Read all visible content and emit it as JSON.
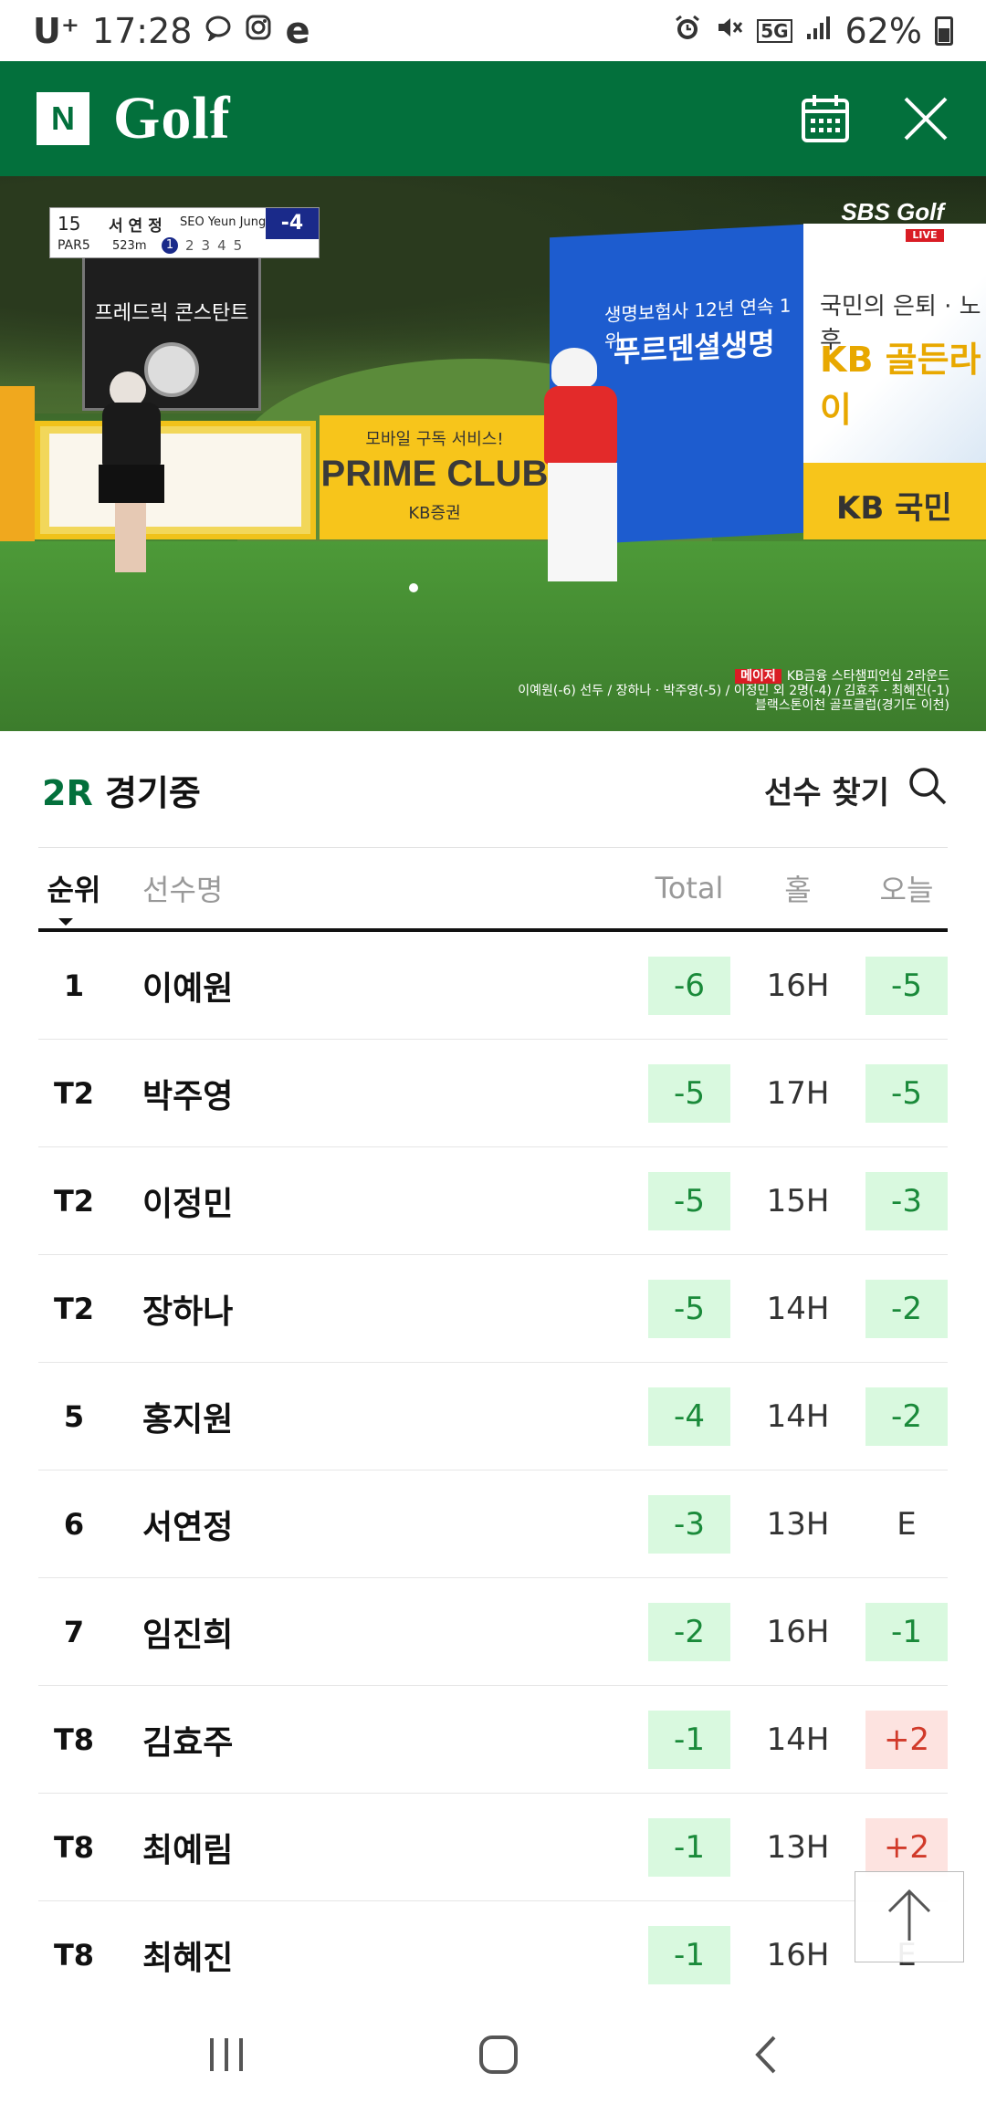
{
  "status_bar": {
    "carrier": "U⁺",
    "time": "17:28",
    "network": "5G",
    "battery": "62%"
  },
  "app": {
    "logo_letter": "N",
    "title": "Golf"
  },
  "video": {
    "score_overlay": {
      "hole": "15",
      "par": "PAR5",
      "player_kr": "서 연 정",
      "player_en": "SEO Yeun Jung",
      "distance": "523m",
      "shots": [
        "1",
        "2",
        "3",
        "4",
        "5"
      ],
      "relative": "-4"
    },
    "broadcaster": "SBS Golf",
    "live": "LIVE",
    "ticker_tag": "메이저",
    "ticker_line1": "KB금융 스타챔피언십 2라운드",
    "ticker_line2": "이예원(-6) 선두 / 장하나 · 박주영(-5) / 이정민 외 2명(-4) / 김효주 · 최혜진(-1)",
    "ticker_line3": "블랙스톤이천 골프클럽(경기도 이천)",
    "signs": {
      "dark_sign": "프레드릭 콘스탄트",
      "prime_small": "모바일 구독 서비스!",
      "prime_big": "PRIME CLUB",
      "prime_kb": "KB증권",
      "blue_line1": "생명보험사 12년 연속 1위",
      "blue_line2": "푸르덴셜생명",
      "kb_line1": "국민의 은퇴 · 노후",
      "kb_line2": "KB 골든라이",
      "kb_bottom": "KB 국민"
    }
  },
  "leaderboard": {
    "round_highlight": "2R",
    "round_status": "경기중",
    "search_label": "선수 찾기",
    "columns": {
      "rank": "순위",
      "name": "선수명",
      "total": "Total",
      "hole": "홀",
      "today": "오늘"
    },
    "rows": [
      {
        "rank": "1",
        "name": "이예원",
        "total": "-6",
        "hole": "16H",
        "today": "-5",
        "today_kind": "neg"
      },
      {
        "rank": "T2",
        "name": "박주영",
        "total": "-5",
        "hole": "17H",
        "today": "-5",
        "today_kind": "neg"
      },
      {
        "rank": "T2",
        "name": "이정민",
        "total": "-5",
        "hole": "15H",
        "today": "-3",
        "today_kind": "neg"
      },
      {
        "rank": "T2",
        "name": "장하나",
        "total": "-5",
        "hole": "14H",
        "today": "-2",
        "today_kind": "neg"
      },
      {
        "rank": "5",
        "name": "홍지원",
        "total": "-4",
        "hole": "14H",
        "today": "-2",
        "today_kind": "neg"
      },
      {
        "rank": "6",
        "name": "서연정",
        "total": "-3",
        "hole": "13H",
        "today": "E",
        "today_kind": "even"
      },
      {
        "rank": "7",
        "name": "임진희",
        "total": "-2",
        "hole": "16H",
        "today": "-1",
        "today_kind": "neg"
      },
      {
        "rank": "T8",
        "name": "김효주",
        "total": "-1",
        "hole": "14H",
        "today": "+2",
        "today_kind": "pos"
      },
      {
        "rank": "T8",
        "name": "최예림",
        "total": "-1",
        "hole": "13H",
        "today": "+2",
        "today_kind": "pos"
      },
      {
        "rank": "T8",
        "name": "최혜진",
        "total": "-1",
        "hole": "16H",
        "today": "E",
        "today_kind": "even"
      }
    ]
  },
  "colors": {
    "brand_green": "#03703c",
    "under_par_bg": "#d9f9df",
    "over_par_bg": "#fde3e0"
  }
}
